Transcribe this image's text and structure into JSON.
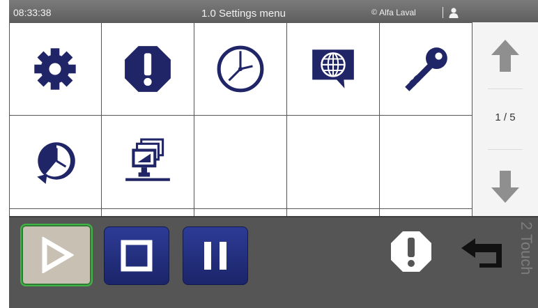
{
  "status_bar": {
    "time": "08:33:38",
    "title": "1.0 Settings menu",
    "brand": "Alfa Laval",
    "brand_mark": "©"
  },
  "menu_grid": {
    "items": [
      {
        "icon": "gear-icon"
      },
      {
        "icon": "alarm-icon"
      },
      {
        "icon": "clock-icon"
      },
      {
        "icon": "language-globe-icon"
      },
      {
        "icon": "key-icon"
      },
      {
        "icon": "clock-reset-icon"
      },
      {
        "icon": "network-icon"
      }
    ]
  },
  "pager": {
    "page_text": "1 / 5",
    "up_icon": "arrow-up-icon",
    "down_icon": "arrow-down-icon"
  },
  "controls": {
    "play_icon": "play-icon",
    "stop_icon": "stop-icon",
    "pause_icon": "pause-icon",
    "alarm_icon": "alarm-icon",
    "back_icon": "back-arrow-icon",
    "logo_text": "2 Touch"
  },
  "colors": {
    "icon_navy": "#1f2566",
    "play_active_border": "#41b447",
    "control_blue": "#27338a"
  }
}
